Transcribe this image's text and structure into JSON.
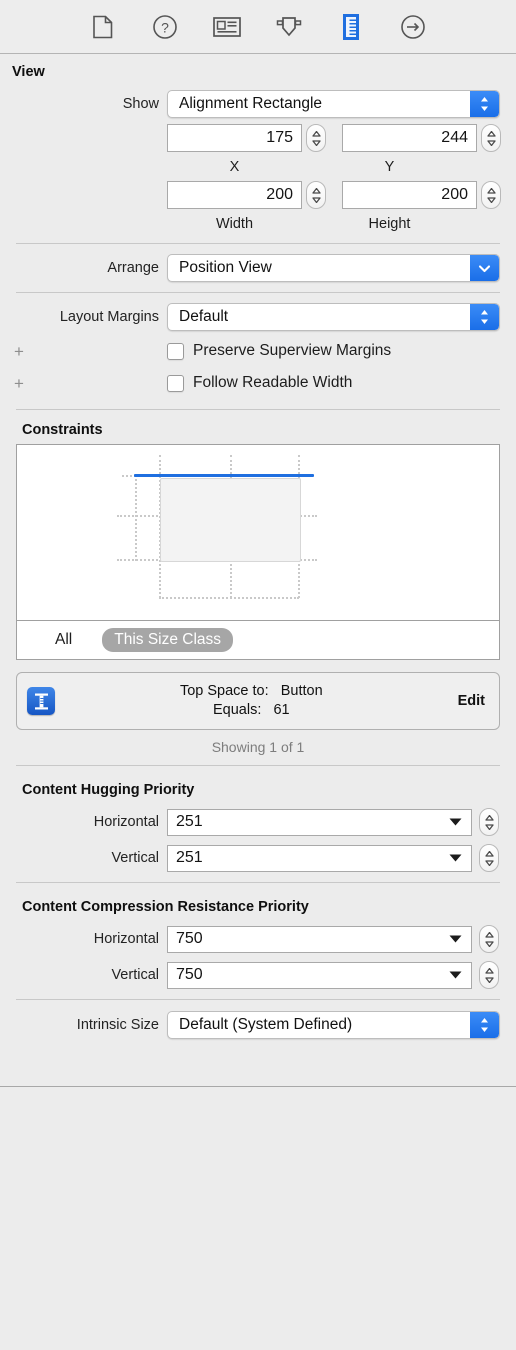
{
  "toolbar": {
    "items": [
      {
        "name": "file-inspector-icon",
        "label": "File inspector"
      },
      {
        "name": "quick-help-inspector-icon",
        "label": "Quick Help inspector"
      },
      {
        "name": "identity-inspector-icon",
        "label": "Identity inspector"
      },
      {
        "name": "attributes-inspector-icon",
        "label": "Attributes inspector"
      },
      {
        "name": "size-inspector-icon",
        "label": "Size inspector"
      },
      {
        "name": "connections-inspector-icon",
        "label": "Connections inspector"
      }
    ],
    "selected_index": 4,
    "accent_color": "#1f6fe0"
  },
  "view_section": {
    "title": "View",
    "show_label": "Show",
    "show_value": "Alignment Rectangle",
    "fields": [
      {
        "label": "X",
        "value": "175"
      },
      {
        "label": "Y",
        "value": "244"
      },
      {
        "label": "Width",
        "value": "200"
      },
      {
        "label": "Height",
        "value": "200"
      }
    ]
  },
  "arrange": {
    "label": "Arrange",
    "value": "Position View"
  },
  "layout_margins": {
    "label": "Layout Margins",
    "value": "Default",
    "checkboxes": [
      {
        "label": "Preserve Superview Margins",
        "checked": false,
        "add_glyph": "+"
      },
      {
        "label": "Follow Readable Width",
        "checked": false,
        "add_glyph": "+"
      }
    ]
  },
  "constraints": {
    "title": "Constraints",
    "segments": [
      {
        "label": "All",
        "selected": false
      },
      {
        "label": "This Size Class",
        "selected": true
      }
    ],
    "detail": {
      "icon": "constraint-ruler-icon",
      "relation_label": "Top Space to:",
      "relation_value": "Button",
      "equals_label": "Equals:",
      "equals_value": "61",
      "edit_label": "Edit"
    },
    "showing_text": "Showing 1 of 1",
    "constraint_line_color": "#1f6fe0"
  },
  "content_hugging": {
    "title": "Content Hugging Priority",
    "rows": [
      {
        "label": "Horizontal",
        "value": "251"
      },
      {
        "label": "Vertical",
        "value": "251"
      }
    ]
  },
  "content_compression": {
    "title": "Content Compression Resistance Priority",
    "rows": [
      {
        "label": "Horizontal",
        "value": "750"
      },
      {
        "label": "Vertical",
        "value": "750"
      }
    ]
  },
  "intrinsic_size": {
    "label": "Intrinsic Size",
    "value": "Default (System Defined)"
  }
}
